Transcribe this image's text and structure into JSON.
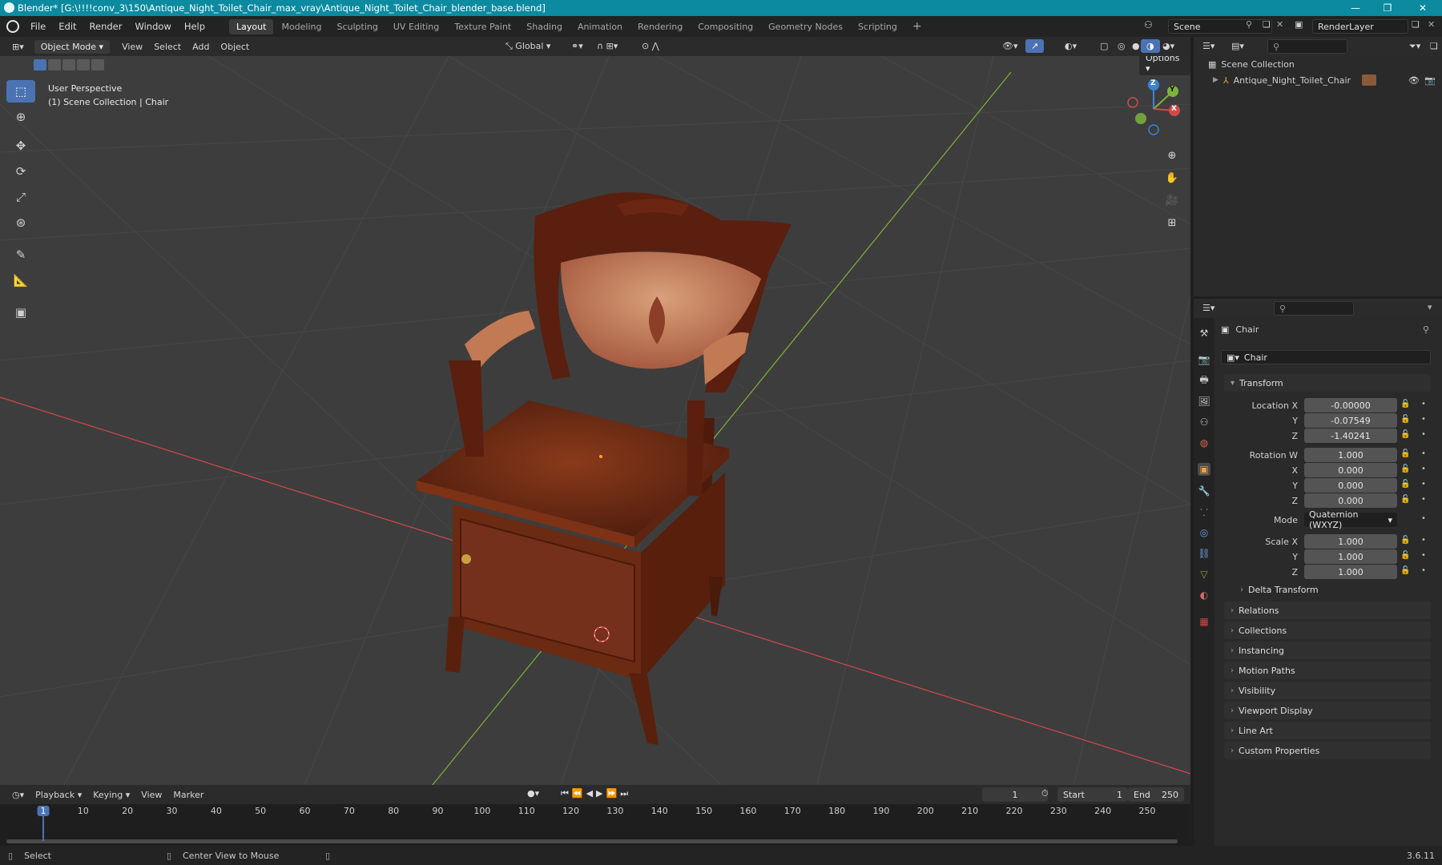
{
  "titlebar": {
    "title": "Blender* [G:\\!!!!conv_3\\150\\Antique_Night_Toilet_Chair_max_vray\\Antique_Night_Toilet_Chair_blender_base.blend]"
  },
  "menu": [
    "File",
    "Edit",
    "Render",
    "Window",
    "Help"
  ],
  "workspaces": [
    "Layout",
    "Modeling",
    "Sculpting",
    "UV Editing",
    "Texture Paint",
    "Shading",
    "Animation",
    "Rendering",
    "Compositing",
    "Geometry Nodes",
    "Scripting"
  ],
  "active_workspace": "Layout",
  "scene": {
    "name": "Scene"
  },
  "render_layer": {
    "name": "RenderLayer"
  },
  "viewport_header": {
    "mode": "Object Mode",
    "menus": [
      "View",
      "Select",
      "Add",
      "Object"
    ],
    "orientation": "Global",
    "options": "Options"
  },
  "viewport": {
    "perspective": "User Perspective",
    "collection_info": "(1) Scene Collection | Chair"
  },
  "gizmo": {
    "x": "X",
    "y": "Y",
    "z": "Z"
  },
  "outliner": {
    "root": "Scene Collection",
    "items": [
      {
        "label": "Antique_Night_Toilet_Chair"
      }
    ]
  },
  "properties": {
    "object_name": "Chair",
    "data_name": "Chair",
    "transform_title": "Transform",
    "location": {
      "label": "Location X",
      "x": "-0.00000",
      "y": "-0.07549",
      "z": "-1.40241"
    },
    "rotation": {
      "label": "Rotation W",
      "w": "1.000",
      "x": "0.000",
      "y": "0.000",
      "z": "0.000"
    },
    "axis_labels": {
      "x": "X",
      "y": "Y",
      "z": "Z"
    },
    "mode_label": "Mode",
    "mode_value": "Quaternion (WXYZ)",
    "scale": {
      "label": "Scale X",
      "x": "1.000",
      "y": "1.000",
      "z": "1.000"
    },
    "delta": "Delta Transform",
    "panels": [
      "Relations",
      "Collections",
      "Instancing",
      "Motion Paths",
      "Visibility",
      "Viewport Display",
      "Line Art",
      "Custom Properties"
    ]
  },
  "timeline": {
    "menus": [
      "Playback",
      "Keying",
      "View",
      "Marker"
    ],
    "current_frame": "1",
    "start_label": "Start",
    "start": "1",
    "end_label": "End",
    "end": "250",
    "ticks": [
      "1",
      "10",
      "20",
      "30",
      "40",
      "50",
      "60",
      "70",
      "80",
      "90",
      "100",
      "110",
      "120",
      "130",
      "140",
      "150",
      "160",
      "170",
      "180",
      "190",
      "200",
      "210",
      "220",
      "230",
      "240",
      "250"
    ]
  },
  "statusbar": {
    "left": "Select",
    "middle": "Center View to Mouse",
    "version": "3.6.11"
  },
  "colors": {
    "titlebar": "#0b8aa0",
    "accent": "#4b73b4",
    "x_axis": "#d44848",
    "y_axis": "#7eb23a",
    "z_axis": "#3d82d6"
  }
}
